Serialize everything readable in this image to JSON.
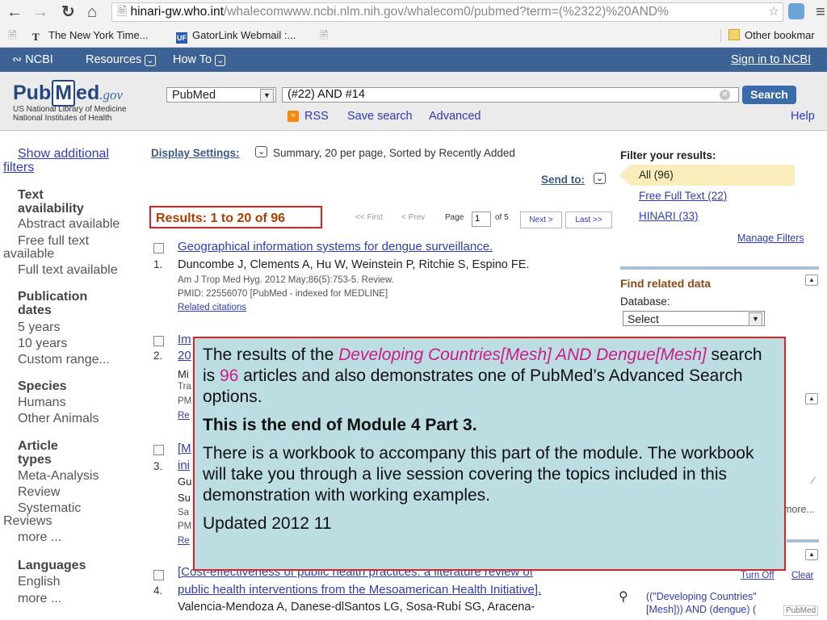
{
  "browser": {
    "url_host": "hinari-gw.who.int",
    "url_path": "/whalecomwww.ncbi.nlm.nih.gov/whalecom0/pubmed?term=(%2322)%20AND%",
    "bookmarks": [
      {
        "label": "The New York Time..."
      },
      {
        "label": "GatorLink Webmail :..."
      },
      {
        "label": "Other bookmar"
      }
    ],
    "bookmark_icons": {
      "nyt": "T",
      "gatorlink": "UF"
    }
  },
  "ncbi_bar": {
    "logo": "NCBI",
    "resources": "Resources",
    "howto": "How To",
    "signin": "Sign in to NCBI"
  },
  "header": {
    "logo_pub": "Pub",
    "logo_m": "M",
    "logo_ed": "ed",
    "logo_gov": ".gov",
    "nlm_line1": "US National Library of Medicine",
    "nlm_line2": "National Institutes of Health",
    "database": "PubMed",
    "term": "(#22) AND #14",
    "search_label": "Search",
    "rss": "RSS",
    "save_search": "Save search",
    "advanced": "Advanced",
    "help": "Help"
  },
  "sidebar": {
    "show_additional_1": "Show additional",
    "show_additional_2": "filters",
    "text_avail_h1": "Text",
    "text_avail_h2": "availability",
    "abstract": "Abstract available",
    "free_1": "Free full text",
    "free_2": "available",
    "full_text": "Full text available",
    "pub_h1": "Publication",
    "pub_h2": "dates",
    "y5": "5 years",
    "y10": "10 years",
    "custom": "Custom range...",
    "species_h": "Species",
    "humans": "Humans",
    "other_animals": "Other Animals",
    "article_h1": "Article",
    "article_h2": "types",
    "meta": "Meta-Analysis",
    "review": "Review",
    "systematic_1": "Systematic",
    "systematic_2": "Reviews",
    "more1": "more ...",
    "lang_h": "Languages",
    "english": "English",
    "more2": "more ..."
  },
  "results": {
    "display_settings": "Display Settings:",
    "display_desc": "Summary, 20 per page, Sorted by Recently Added",
    "send_to": "Send to:",
    "count_label": "Results: 1 to 20 of 96",
    "pager_first": "<< First",
    "pager_prev": "< Prev",
    "page_label": "Page",
    "page_value": "1",
    "of_pages": "of 5",
    "next": "Next >",
    "last": "Last >>",
    "items": [
      {
        "num": "1.",
        "title": "Geographical information systems for dengue surveillance.",
        "authors": "Duncombe J, Clements A, Hu W, Weinstein P, Ritchie S, Espino FE.",
        "journal": "Am J Trop Med Hyg. 2012 May;86(5):753-5. Review.",
        "pmid": "PMID: 22556070 [PubMed - indexed for MEDLINE]",
        "related": "Related citations"
      },
      {
        "num": "2.",
        "title_fragment_1": "Im",
        "title_fragment_2": "20",
        "frag_a": "Mi",
        "frag_b": "Tra",
        "frag_c": "PM",
        "frag_d": "Re"
      },
      {
        "num": "3.",
        "title_fragment_1": "[M",
        "title_fragment_2": "ini",
        "frag_a": "Gu",
        "frag_b": "Su",
        "frag_c": "Sa",
        "frag_d": "PM",
        "frag_e": "Re"
      },
      {
        "num": "4.",
        "title_1": "[Cost-effectiveness of public health practices: a literature review of",
        "title_2": "public health interventions from the Mesoamerican Health Initiative].",
        "authors": "Valencia-Mendoza A, Danese-dlSantos LG, Sosa-Rubí SG, Aracena-"
      }
    ]
  },
  "right": {
    "filter_title": "Filter your results:",
    "all": "All (96)",
    "free_full": "Free Full Text (22)",
    "hinari": "HINARI (33)",
    "manage": "Manage Filters",
    "related_title": "Find related data",
    "database_label": "Database:",
    "select": "Select",
    "more": "more...",
    "turn_off": "Turn Off",
    "clear": "Clear",
    "history_1": "((\"Developing Countries\"",
    "history_2": "[Mesh])) AND (dengue) (",
    "history_tag": "PubMed"
  },
  "overlay": {
    "p1_a": "The results of the ",
    "p1_mesh": "Developing Countries[Mesh] AND Dengue[Mesh]",
    "p1_b": " search is ",
    "p1_count": "96",
    "p1_c": " articles and also demonstrates one of PubMed’s Advanced Search options.",
    "p2": "This is the end of Module 4 Part 3.",
    "p3": "There is a workbook to accompany this part of the module. The workbook will take you through a live session covering the topics included in this demonstration with working examples.",
    "p4": "Updated 2012 11"
  }
}
